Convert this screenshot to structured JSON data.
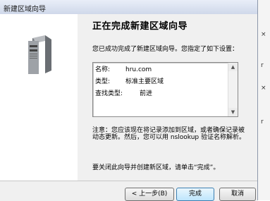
{
  "window": {
    "title": "新建区域向导"
  },
  "heading": "正在完成新建区域向导",
  "intro": "您已成功完成了新建区域向导。您指定了如下设置：",
  "summary": {
    "rows": [
      {
        "key": "名称:",
        "value": "hru.com"
      },
      {
        "key": "类型:",
        "value": "标准主要区域"
      },
      {
        "key": "查找类型:",
        "value": "前进"
      }
    ]
  },
  "note": "注意：您应该现在将记录添加到区域，或者确保记录被动态更新。然后，您可以用 nslookup 验证名称解析。",
  "closing": "要关闭此向导并创建新区域，请单击“完成”。",
  "buttons": {
    "back": "< 上一步(B)",
    "finish": "完成",
    "cancel": "取消"
  },
  "background_glyphs": [
    "×",
    "r",
    "×",
    "r"
  ]
}
